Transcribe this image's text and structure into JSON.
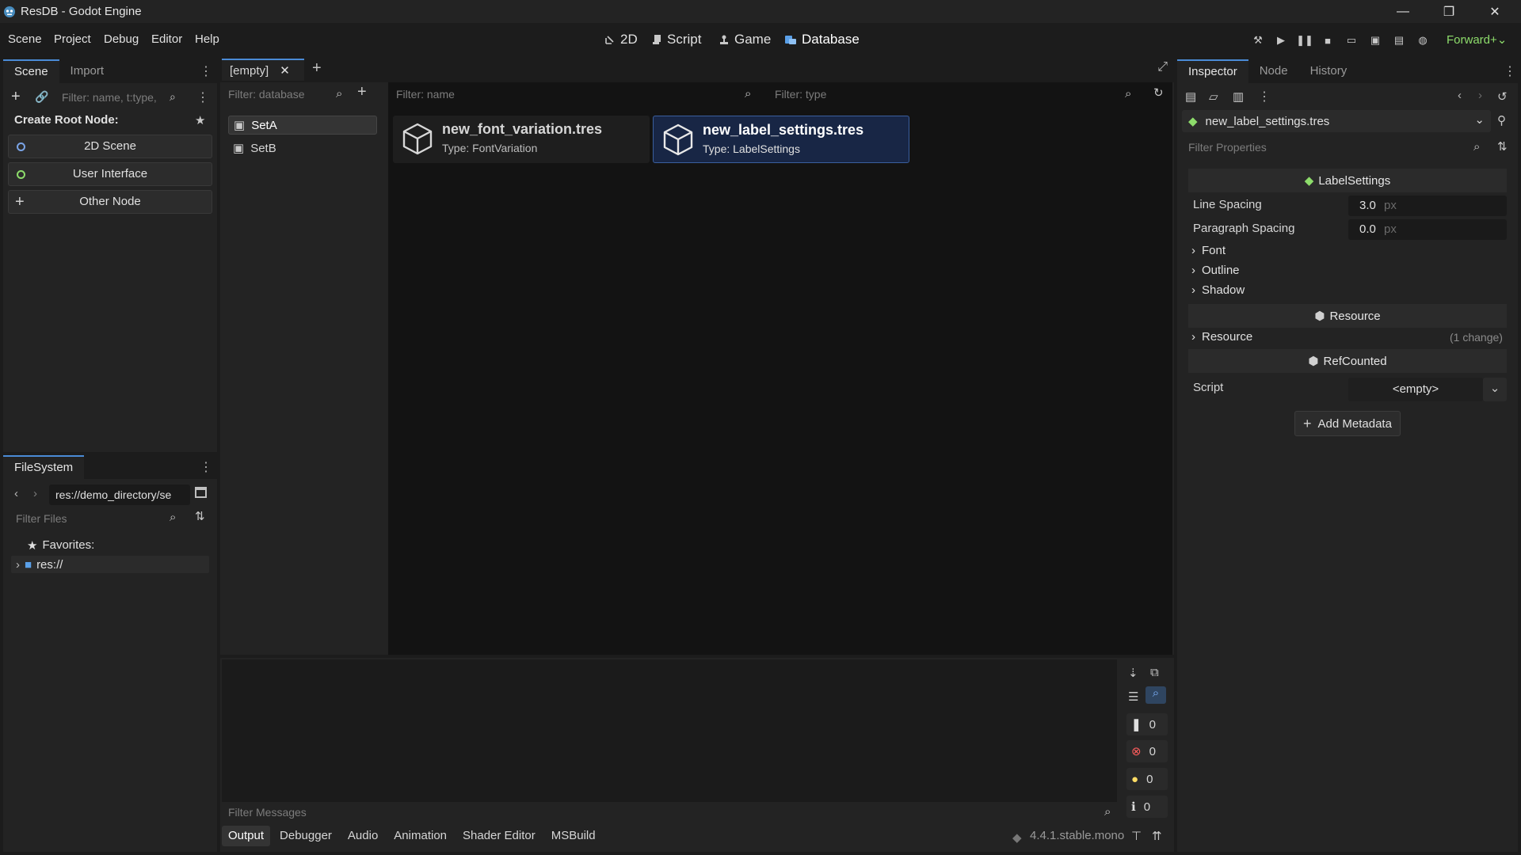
{
  "window": {
    "title": "ResDB - Godot Engine",
    "minimize": "—",
    "maximize": "❐",
    "close": "✕"
  },
  "menu": [
    "Scene",
    "Project",
    "Debug",
    "Editor",
    "Help"
  ],
  "workspaces": [
    {
      "label": "2D",
      "icon": "2d-icon"
    },
    {
      "label": "Script",
      "icon": "script-icon"
    },
    {
      "label": "Game",
      "icon": "game-icon"
    },
    {
      "label": "Database",
      "icon": "database-icon"
    }
  ],
  "renderer": "Forward+",
  "scene_dock": {
    "tabs": [
      "Scene",
      "Import"
    ],
    "filter_placeholder": "Filter: name, t:type,",
    "create_root_label": "Create Root Node:",
    "buttons": [
      "2D Scene",
      "User Interface",
      "Other Node"
    ]
  },
  "filesystem": {
    "tab": "FileSystem",
    "path": "res://demo_directory/se",
    "filter_placeholder": "Filter Files",
    "favorites": "Favorites:",
    "root": "res://"
  },
  "scene_tabs": {
    "current": "[empty]"
  },
  "database": {
    "filter_db_placeholder": "Filter: database",
    "filter_name_placeholder": "Filter: name",
    "filter_type_placeholder": "Filter: type",
    "sets": [
      "SetA",
      "SetB"
    ],
    "resources": [
      {
        "name": "new_font_variation.tres",
        "type": "Type: FontVariation",
        "selected": false
      },
      {
        "name": "new_label_settings.tres",
        "type": "Type: LabelSettings",
        "selected": true
      }
    ]
  },
  "output": {
    "filter_placeholder": "Filter Messages",
    "counts": [
      "0",
      "0",
      "0",
      "0"
    ],
    "tabs": [
      "Output",
      "Debugger",
      "Audio",
      "Animation",
      "Shader Editor",
      "MSBuild"
    ],
    "version": "4.4.1.stable.mono"
  },
  "inspector": {
    "tabs": [
      "Inspector",
      "Node",
      "History"
    ],
    "resource": "new_label_settings.tres",
    "filter_placeholder": "Filter Properties",
    "class_header": "LabelSettings",
    "line_spacing_label": "Line Spacing",
    "line_spacing_value": "3.0",
    "paragraph_spacing_label": "Paragraph Spacing",
    "paragraph_spacing_value": "0.0",
    "unit": "px",
    "groups": [
      "Font",
      "Outline",
      "Shadow"
    ],
    "resource_header": "Resource",
    "resource_group": "Resource",
    "resource_change": "(1 change)",
    "refcounted_header": "RefCounted",
    "script_label": "Script",
    "script_value": "<empty>",
    "add_metadata": "Add Metadata"
  }
}
